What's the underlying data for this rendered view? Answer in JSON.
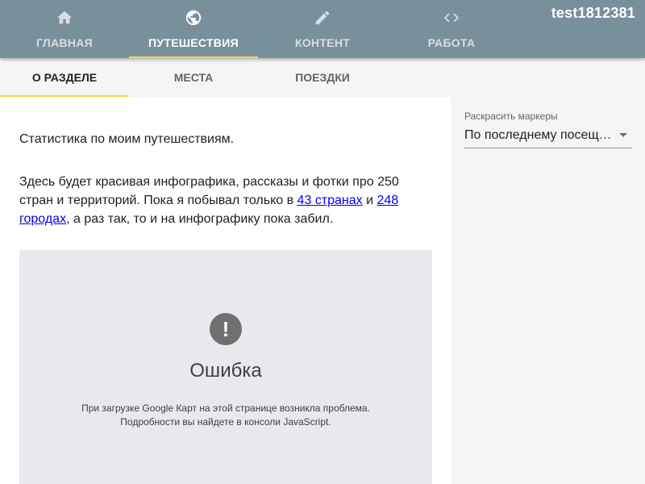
{
  "header": {
    "username": "test1812381",
    "tabs": [
      {
        "label": "ГЛАВНАЯ",
        "icon": "home-icon"
      },
      {
        "label": "ПУТЕШЕСТВИЯ",
        "icon": "globe-icon"
      },
      {
        "label": "КОНТЕНТ",
        "icon": "pencil-icon"
      },
      {
        "label": "РАБОТА",
        "icon": "code-icon"
      }
    ],
    "active_tab": "ПУТЕШЕСТВИЯ",
    "accent_color": "#fdd835",
    "bar_color": "#78909c"
  },
  "subtabs": {
    "items": [
      {
        "label": "О РАЗДЕЛЕ"
      },
      {
        "label": "МЕСТА"
      },
      {
        "label": "ПОЕЗДКИ"
      }
    ],
    "active": "О РАЗДЕЛЕ"
  },
  "main": {
    "intro": "Статистика по моим путешествиям.",
    "para_before": "Здесь будет красивая инфографика, рассказы и фотки про 250 стран и территорий. Пока я побывал только в ",
    "countries_link": "43 странах",
    "and_word": " и ",
    "cities_link": "248 городах",
    "para_after": ", а раз так, то и на инфографику пока забил."
  },
  "map_error": {
    "icon": "exclamation-icon",
    "symbol": "!",
    "title": "Ошибка",
    "message_line1": "При загрузке Google Карт на этой странице возникла проблема.",
    "message_line2": "Подробности вы найдете в консоли JavaScript."
  },
  "side_panel": {
    "label": "Раскрасить маркеры",
    "selected": "По последнему посещению"
  }
}
